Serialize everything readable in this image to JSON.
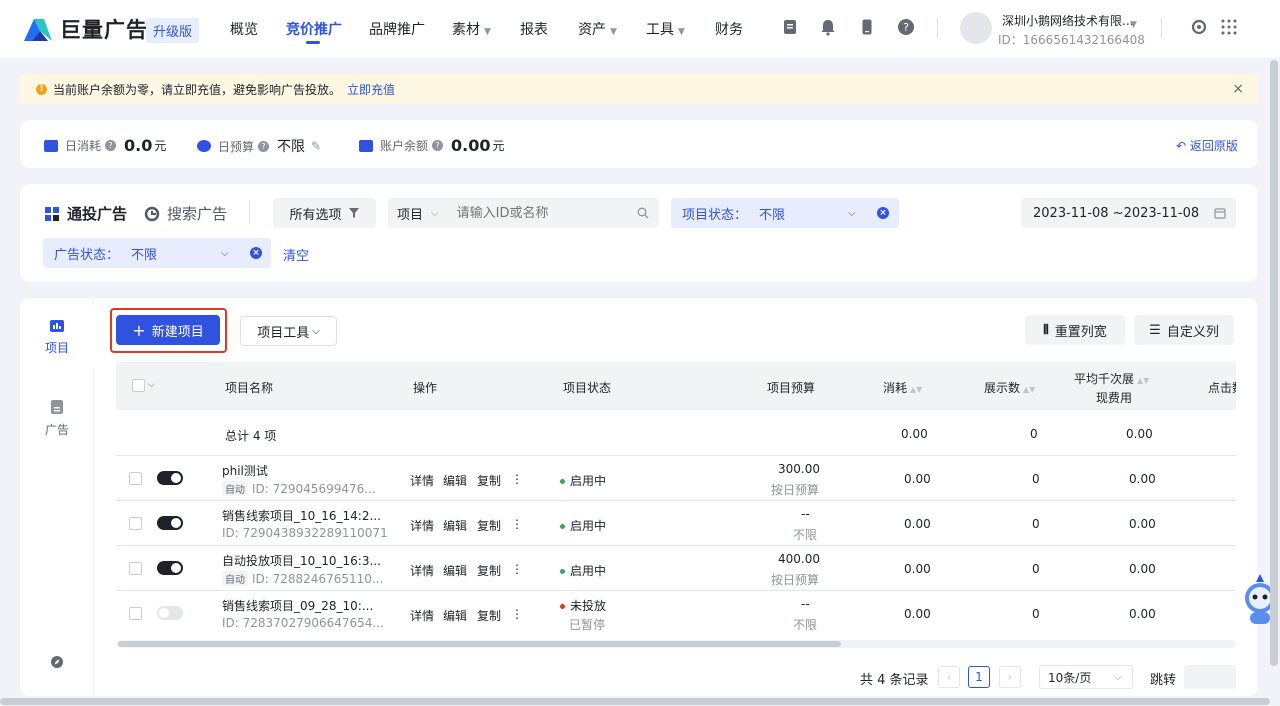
{
  "brand": {
    "name": "巨量广告",
    "upgrade": "升级版"
  },
  "nav": {
    "items": [
      {
        "label": "概览",
        "caret": ""
      },
      {
        "label": "竞价推广",
        "caret": ""
      },
      {
        "label": "品牌推广",
        "caret": ""
      },
      {
        "label": "素材",
        "caret": "▼"
      },
      {
        "label": "报表",
        "caret": ""
      },
      {
        "label": "资产",
        "caret": "▼"
      },
      {
        "label": "工具",
        "caret": "▼"
      },
      {
        "label": "财务",
        "caret": ""
      }
    ]
  },
  "account": {
    "name": "深圳小鹅网络技术有限...",
    "id": "ID：1666561432166408"
  },
  "notice": {
    "text": "当前账户余额为零，请立即充值，避免影响广告投放。",
    "link": "立即充值",
    "close": "×"
  },
  "stats": {
    "daily_cost_label": "日消耗",
    "daily_cost_value": "0.0",
    "daily_cost_unit": "元",
    "daily_budget_label": "日预算",
    "daily_budget_value": "不限",
    "balance_label": "账户余额",
    "balance_value": "0.00",
    "balance_unit": "元",
    "back_label": "返回原版"
  },
  "filters": {
    "tab_tongtou": "通投广告",
    "tab_search": "搜索广告",
    "all_options": "所有选项",
    "project_select": "项目",
    "search_placeholder": "请输入ID或名称",
    "project_status_label": "项目状态：",
    "project_status_value": "不限",
    "date_range": "2023-11-08 ~2023-11-08",
    "ad_status_label": "广告状态：",
    "ad_status_value": "不限",
    "clear": "清空"
  },
  "sidebar": {
    "project": "项目",
    "ad": "广告"
  },
  "toolbar": {
    "new_project": "新建项目",
    "project_tools": "项目工具",
    "reset_width": "重置列宽",
    "custom_columns": "自定义列"
  },
  "table": {
    "headers": {
      "name": "项目名称",
      "ops": "操作",
      "status": "项目状态",
      "budget": "项目预算",
      "cost": "消耗",
      "impressions": "展示数",
      "cpm_line1": "平均千次展",
      "cpm_line2": "现费用",
      "clicks": "点击数"
    },
    "summary": {
      "label": "总计 4 项",
      "cost": "0.00",
      "impressions": "0",
      "cpm": "0.00"
    },
    "rows": [
      {
        "name": "phil测试",
        "auto_tag": "自动",
        "id": "ID: 729045699476...",
        "ops": [
          "详情",
          "编辑",
          "复制",
          "⋮"
        ],
        "status": "启用中",
        "status_sub": "",
        "budget": "300.00",
        "budget_sub": "按日预算",
        "cost": "0.00",
        "impressions": "0",
        "cpm": "0.00",
        "enabled": true
      },
      {
        "name": "销售线索项目_10_16_14:2...",
        "auto_tag": "",
        "id": "ID: 7290438932289110071",
        "ops": [
          "详情",
          "编辑",
          "复制",
          "⋮"
        ],
        "status": "启用中",
        "status_sub": "",
        "budget": "--",
        "budget_sub": "不限",
        "cost": "0.00",
        "impressions": "0",
        "cpm": "0.00",
        "enabled": true
      },
      {
        "name": "自动投放项目_10_10_16:3...",
        "auto_tag": "自动",
        "id": "ID: 7288246765110...",
        "ops": [
          "详情",
          "编辑",
          "复制",
          "⋮"
        ],
        "status": "启用中",
        "status_sub": "",
        "budget": "400.00",
        "budget_sub": "按日预算",
        "cost": "0.00",
        "impressions": "0",
        "cpm": "0.00",
        "enabled": true
      },
      {
        "name": "销售线索项目_09_28_10:...",
        "auto_tag": "",
        "id": "ID: 72837027906647654...",
        "ops": [
          "详情",
          "编辑",
          "复制",
          "⋮"
        ],
        "status": "未投放",
        "status_sub": "已暂停",
        "budget": "--",
        "budget_sub": "不限",
        "cost": "0.00",
        "impressions": "0",
        "cpm": "0.00",
        "enabled": false
      }
    ]
  },
  "pager": {
    "total": "共 4 条记录",
    "current": "1",
    "page_size": "10条/页",
    "jump": "跳转"
  },
  "colors": {
    "primary": "#2f52e0",
    "active_status": "#3aa55a",
    "paused_status": "#e0391f",
    "highlight": "#e0391f"
  }
}
